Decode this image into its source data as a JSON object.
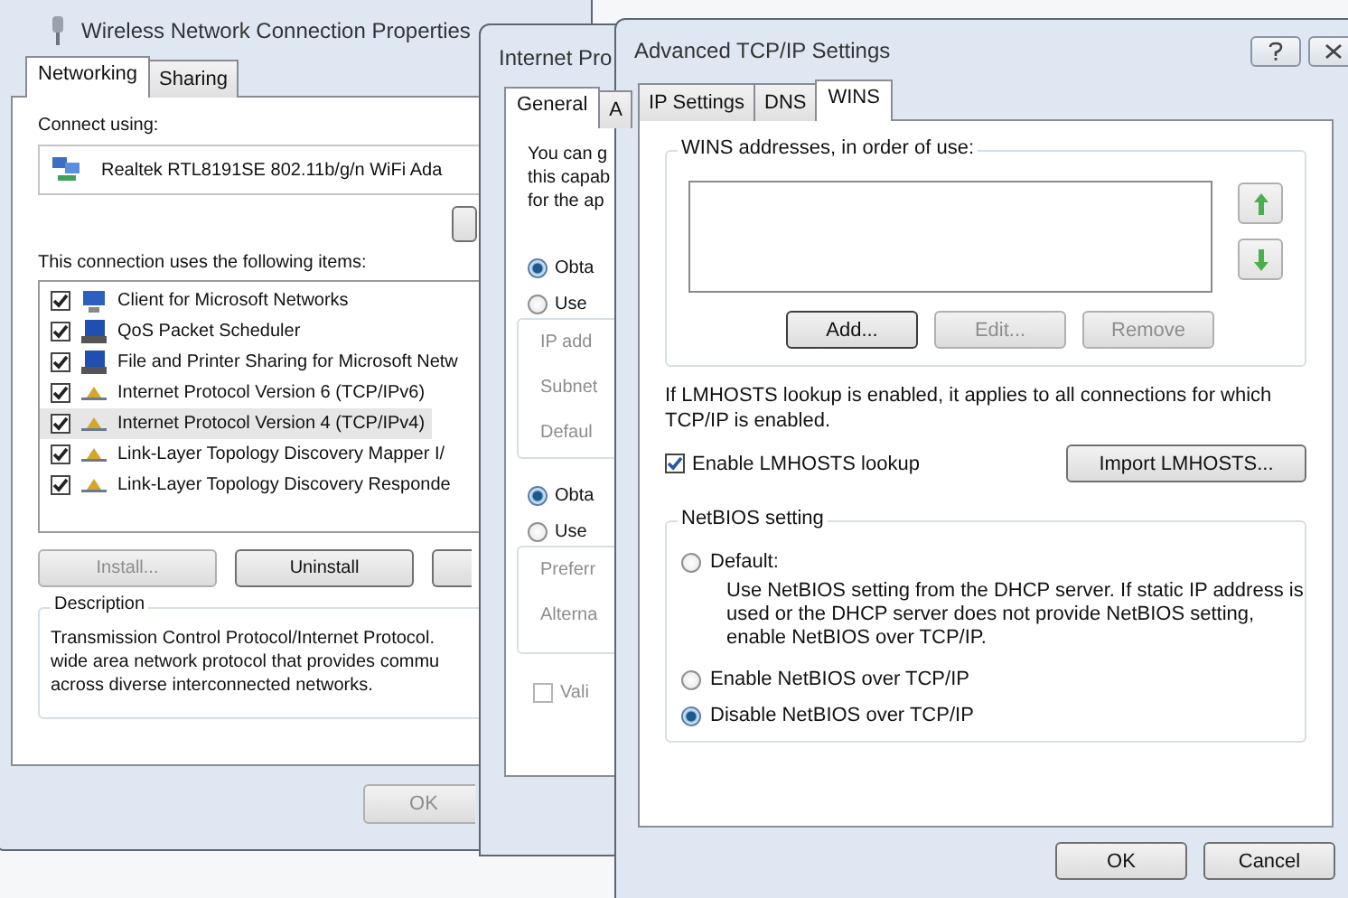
{
  "back_window": {
    "title": "Wireless Network Connection Properties",
    "tabs": [
      {
        "label": "Networking",
        "selected": true
      },
      {
        "label": "Sharing",
        "selected": false
      }
    ],
    "connect_using_label": "Connect using:",
    "adapter": "Realtek RTL8191SE 802.11b/g/n WiFi Ada",
    "items_label": "This connection uses the following items:",
    "items": [
      {
        "label": "Client for Microsoft Networks",
        "checked": true,
        "selected": false,
        "kind": "client"
      },
      {
        "label": "QoS Packet Scheduler",
        "checked": true,
        "selected": false,
        "kind": "service"
      },
      {
        "label": "File and Printer Sharing for Microsoft Netw",
        "checked": true,
        "selected": false,
        "kind": "service"
      },
      {
        "label": "Internet Protocol Version 6 (TCP/IPv6)",
        "checked": true,
        "selected": false,
        "kind": "protocol"
      },
      {
        "label": "Internet Protocol Version 4 (TCP/IPv4)",
        "checked": true,
        "selected": true,
        "kind": "protocol"
      },
      {
        "label": "Link-Layer Topology Discovery Mapper I/",
        "checked": true,
        "selected": false,
        "kind": "protocol"
      },
      {
        "label": "Link-Layer Topology Discovery Responde",
        "checked": true,
        "selected": false,
        "kind": "protocol"
      }
    ],
    "buttons": [
      {
        "label": "Install...",
        "disabled": true
      },
      {
        "label": "Uninstall",
        "disabled": false
      }
    ],
    "description": {
      "title": "Description",
      "lines": [
        "Transmission Control Protocol/Internet Protocol.",
        "wide area network protocol that provides commu",
        "across diverse interconnected networks."
      ]
    },
    "ok_button": "OK"
  },
  "middle_window": {
    "title": "Internet Pro",
    "tabs": [
      {
        "label": "General",
        "selected": true
      },
      {
        "label": "A",
        "selected": false
      }
    ],
    "intro_lines": [
      "You can g",
      "this capab",
      "for the ap"
    ],
    "ip_options": [
      {
        "label": "Obta",
        "selected": true
      },
      {
        "label": "Use",
        "selected": false
      }
    ],
    "ip_fields": [
      "IP add",
      "Subnet",
      "Defaul"
    ],
    "dns_options": [
      {
        "label": "Obta",
        "selected": true
      },
      {
        "label": "Use",
        "selected": false
      }
    ],
    "dns_fields": [
      "Preferr",
      "Alterna"
    ],
    "validate": {
      "label": "Vali",
      "checked": false
    }
  },
  "front_window": {
    "title": "Advanced TCP/IP Settings",
    "tabs": [
      {
        "label": "IP Settings",
        "selected": false
      },
      {
        "label": "DNS",
        "selected": false
      },
      {
        "label": "WINS",
        "selected": true
      }
    ],
    "wins_group_title": "WINS addresses, in order of use:",
    "wins_buttons": [
      {
        "label": "Add...",
        "disabled": false
      },
      {
        "label": "Edit...",
        "disabled": true
      },
      {
        "label": "Remove",
        "disabled": true
      }
    ],
    "lmhosts_note": "If LMHOSTS lookup is enabled, it applies to all connections for which TCP/IP is enabled.",
    "lmhosts_checkbox": {
      "label": "Enable LMHOSTS lookup",
      "checked": true
    },
    "import_button": "Import LMHOSTS...",
    "netbios_group_title": "NetBIOS setting",
    "netbios_options": [
      {
        "label": "Default:",
        "selected": false,
        "description": "Use NetBIOS setting from the DHCP server. If static IP address is used or the DHCP server does not provide NetBIOS setting, enable NetBIOS over TCP/IP."
      },
      {
        "label": "Enable NetBIOS over TCP/IP",
        "selected": false
      },
      {
        "label": "Disable NetBIOS over TCP/IP",
        "selected": true
      }
    ],
    "ok_button": "OK",
    "cancel_button": "Cancel"
  }
}
